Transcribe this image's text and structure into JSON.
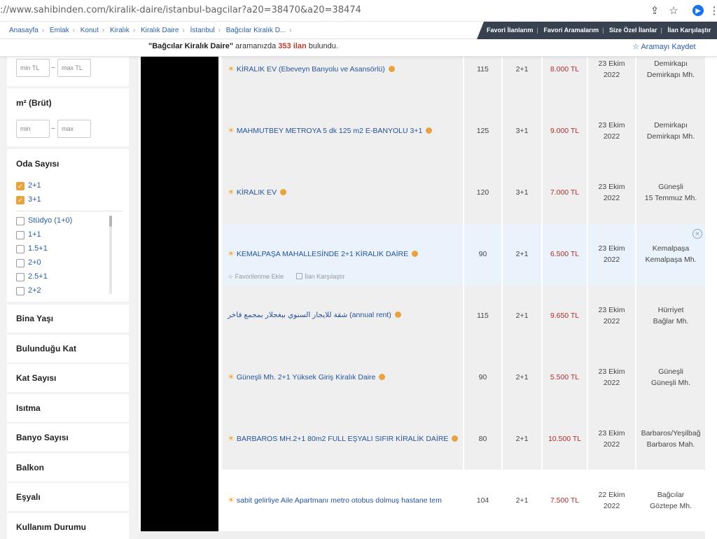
{
  "browser": {
    "url": "://www.sahibinden.com/kiralik-daire/istanbul-bagcilar?a20=38470&a20=38474"
  },
  "breadcrumb": [
    "Anasayfa",
    "Emlak",
    "Konut",
    "Kiralık",
    "Kiralık Daire",
    "İstanbul",
    "Bağcılar Kiralık D..."
  ],
  "top_links": [
    "Favori İlanlarım",
    "Favori Aramalarım",
    "Size Özel İlanlar",
    "İlan Karşılaştır"
  ],
  "summary": {
    "query": "\"Bağcılar Kiralık Daire\"",
    "middle": " aramanızda ",
    "count": "353 ilan",
    "tail": " bulundu.",
    "save_search": "Aramayı Kaydet"
  },
  "filters": {
    "price_min_placeholder": "min TL",
    "price_max_placeholder": "max TL",
    "m2_title": "m² (Brüt)",
    "m2_min_placeholder": "min",
    "m2_max_placeholder": "max",
    "rooms_title": "Oda Sayısı",
    "rooms_selected": [
      "2+1",
      "3+1"
    ],
    "rooms_options": [
      "Stüdyo (1+0)",
      "1+1",
      "1.5+1",
      "2+0",
      "2.5+1",
      "2+2"
    ],
    "sections": [
      "Bina Yaşı",
      "Bulunduğu Kat",
      "Kat Sayısı",
      "Isıtma",
      "Banyo Sayısı",
      "Balkon",
      "Eşyalı",
      "Kullanım Durumu"
    ]
  },
  "listings": [
    {
      "title": "KİRALIK EV (Ebeveyn Banyolu ve Asansörlü)",
      "m2": "115",
      "rooms": "2+1",
      "price": "8.000 TL",
      "date1": "23 Ekim",
      "date2": "2022",
      "loc1": "Demirkapı",
      "loc2": "Demirkapı Mh."
    },
    {
      "title": "MAHMUTBEY METROYA 5 dk 125 m2 E-BANYOLU 3+1",
      "m2": "125",
      "rooms": "3+1",
      "price": "9.000 TL",
      "date1": "23 Ekim",
      "date2": "2022",
      "loc1": "Demirkapı",
      "loc2": "Demirkapı Mh."
    },
    {
      "title": "KİRALIK EV",
      "m2": "120",
      "rooms": "3+1",
      "price": "7.000 TL",
      "date1": "23 Ekim",
      "date2": "2022",
      "loc1": "Güneşli",
      "loc2": "15 Temmuz Mh."
    },
    {
      "title": "KEMALPAŞA MAHALLESİNDE 2+1 KİRALIK DAİRE",
      "m2": "90",
      "rooms": "2+1",
      "price": "6.500 TL",
      "date1": "23 Ekim",
      "date2": "2022",
      "loc1": "Kemalpaşa",
      "loc2": "Kemalpaşa Mh.",
      "fav_label": "Favorilerime Ekle",
      "compare_label": "İlan Karşılaştır"
    },
    {
      "title": "شقة للايجار السنوي ببغجلار بمجمع فاخر (annual rent)",
      "m2": "115",
      "rooms": "2+1",
      "price": "9.650 TL",
      "date1": "23 Ekim",
      "date2": "2022",
      "loc1": "Hürriyet",
      "loc2": "Bağlar Mh."
    },
    {
      "title": "Güneşli Mh. 2+1 Yüksek Giriş Kiralık Daire",
      "m2": "90",
      "rooms": "2+1",
      "price": "5.500 TL",
      "date1": "23 Ekim",
      "date2": "2022",
      "loc1": "Güneşli",
      "loc2": "Güneşli Mh."
    },
    {
      "title": "BARBAROS MH.2+1 80m2 FULL EŞYALI SIFIR KİRALİK DAİRE",
      "m2": "80",
      "rooms": "2+1",
      "price": "10.500 TL",
      "date1": "23 Ekim",
      "date2": "2022",
      "loc1": "Barbaros/Yeşilbağ",
      "loc2": "Barbaros Mah."
    },
    {
      "title": "sabit gelirliye Aile Apartmanı metro otobus dolmuş hastane tem",
      "m2": "104",
      "rooms": "2+1",
      "price": "7.500 TL",
      "date1": "22 Ekim",
      "date2": "2022",
      "loc1": "Bağcılar",
      "loc2": "Göztepe Mh."
    }
  ],
  "colors": {
    "accent": "#e8a33d",
    "link": "#24539c",
    "price": "#b52a2a",
    "topbar": "#374150"
  }
}
